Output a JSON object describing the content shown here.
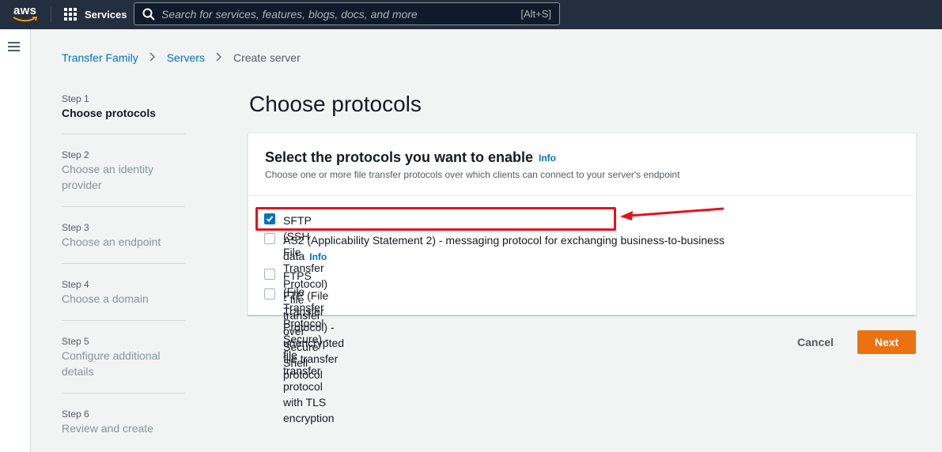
{
  "topnav": {
    "logo_text": "aws",
    "services_label": "Services",
    "search_placeholder": "Search for services, features, blogs, docs, and more",
    "search_shortcut": "[Alt+S]"
  },
  "breadcrumb": {
    "items": [
      "Transfer Family",
      "Servers"
    ],
    "current": "Create server"
  },
  "steps": [
    {
      "number": "Step 1",
      "title": "Choose protocols",
      "active": true
    },
    {
      "number": "Step 2",
      "title": "Choose an identity provider",
      "active": false
    },
    {
      "number": "Step 3",
      "title": "Choose an endpoint",
      "active": false
    },
    {
      "number": "Step 4",
      "title": "Choose a domain",
      "active": false
    },
    {
      "number": "Step 5",
      "title": "Configure additional details",
      "active": false
    },
    {
      "number": "Step 6",
      "title": "Review and create",
      "active": false
    }
  ],
  "page_title": "Choose protocols",
  "panel": {
    "title": "Select the protocols you want to enable",
    "info_label": "Info",
    "description": "Choose one or more file transfer protocols over which clients can connect to your server's endpoint",
    "options": [
      {
        "label": "SFTP (SSH File Transfer Protocol) - file transfer over Secure Shell",
        "checked": true
      },
      {
        "label": "AS2 (Applicability Statement 2) - messaging protocol for exchanging business-to-business",
        "label_line2": "data",
        "info": "Info",
        "checked": false
      },
      {
        "label": "FTPS (File Transfer Protocol Secure) - file transfer protocol with TLS encryption",
        "checked": false
      },
      {
        "label": "FTP (File Transfer Protocol) - unencrypted file transfer protocol",
        "checked": false
      }
    ]
  },
  "actions": {
    "cancel_label": "Cancel",
    "next_label": "Next"
  },
  "colors": {
    "nav_bg": "#232f3e",
    "link": "#0073bb",
    "primary_button": "#ec7211",
    "annotation": "#e6121c"
  }
}
